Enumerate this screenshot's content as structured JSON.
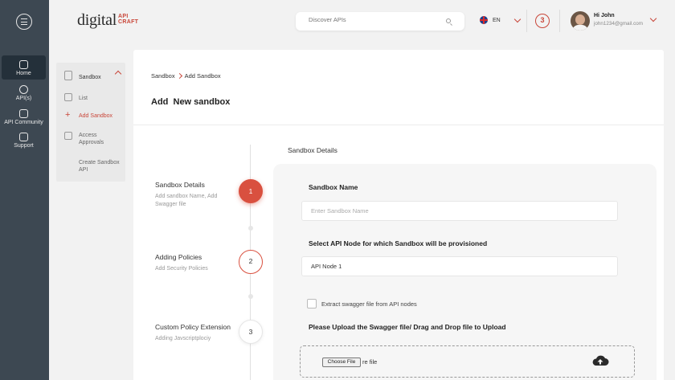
{
  "app": {
    "logo_main": "digital",
    "logo_sub_1": "API",
    "logo_sub_2": "CRAFT"
  },
  "rail": {
    "items": [
      {
        "label": "Home",
        "icon": "home-icon",
        "active": true
      },
      {
        "label": "API(s)",
        "icon": "api-icon"
      },
      {
        "label": "API Community",
        "icon": "community-icon"
      },
      {
        "label": "Support",
        "icon": "support-icon"
      }
    ]
  },
  "header": {
    "search_placeholder": "Discover APIs",
    "language": "EN",
    "notification_count": "3",
    "user_greeting": "Hi John",
    "user_email": "john1234@gmail.com"
  },
  "subnav": {
    "title": "Sandbox",
    "items": [
      {
        "label": "List",
        "icon": "list-icon"
      },
      {
        "label": "Add Sandbox",
        "icon": "plus-icon",
        "active": true
      },
      {
        "label": "Access Approvals",
        "icon": "approvals-icon"
      },
      {
        "label": "Create Sandbox API"
      }
    ]
  },
  "breadcrumb": {
    "parent": "Sandbox",
    "current": "Add Sandbox"
  },
  "page_title": "Add  New sandbox",
  "steps": [
    {
      "number": "1",
      "title": "Sandbox Details",
      "subtitle": "Add sandbox Name, Add Swagger file",
      "state": "active"
    },
    {
      "number": "2",
      "title": "Adding Policies",
      "subtitle": "Add Security Policies",
      "state": "next"
    },
    {
      "number": "3",
      "title": "Custom Policy Extension",
      "subtitle": "Adding Javscriptplociy",
      "state": "pending"
    }
  ],
  "form": {
    "section_label": "Sandbox Details",
    "name_label": "Sandbox Name",
    "name_placeholder": "Enter Sandbox Name",
    "node_label": "Select API Node for which Sandbox will be provisioned",
    "node_value": "API Node 1",
    "checkbox_label": "Extract swagger file from API nodes",
    "upload_label": "Please Upload the Swagger file/ Drag and Drop file to Upload",
    "choose_file_label": "Choose File",
    "file_status": "re file"
  },
  "colors": {
    "accent": "#d9503f",
    "rail": "#3d4852"
  }
}
